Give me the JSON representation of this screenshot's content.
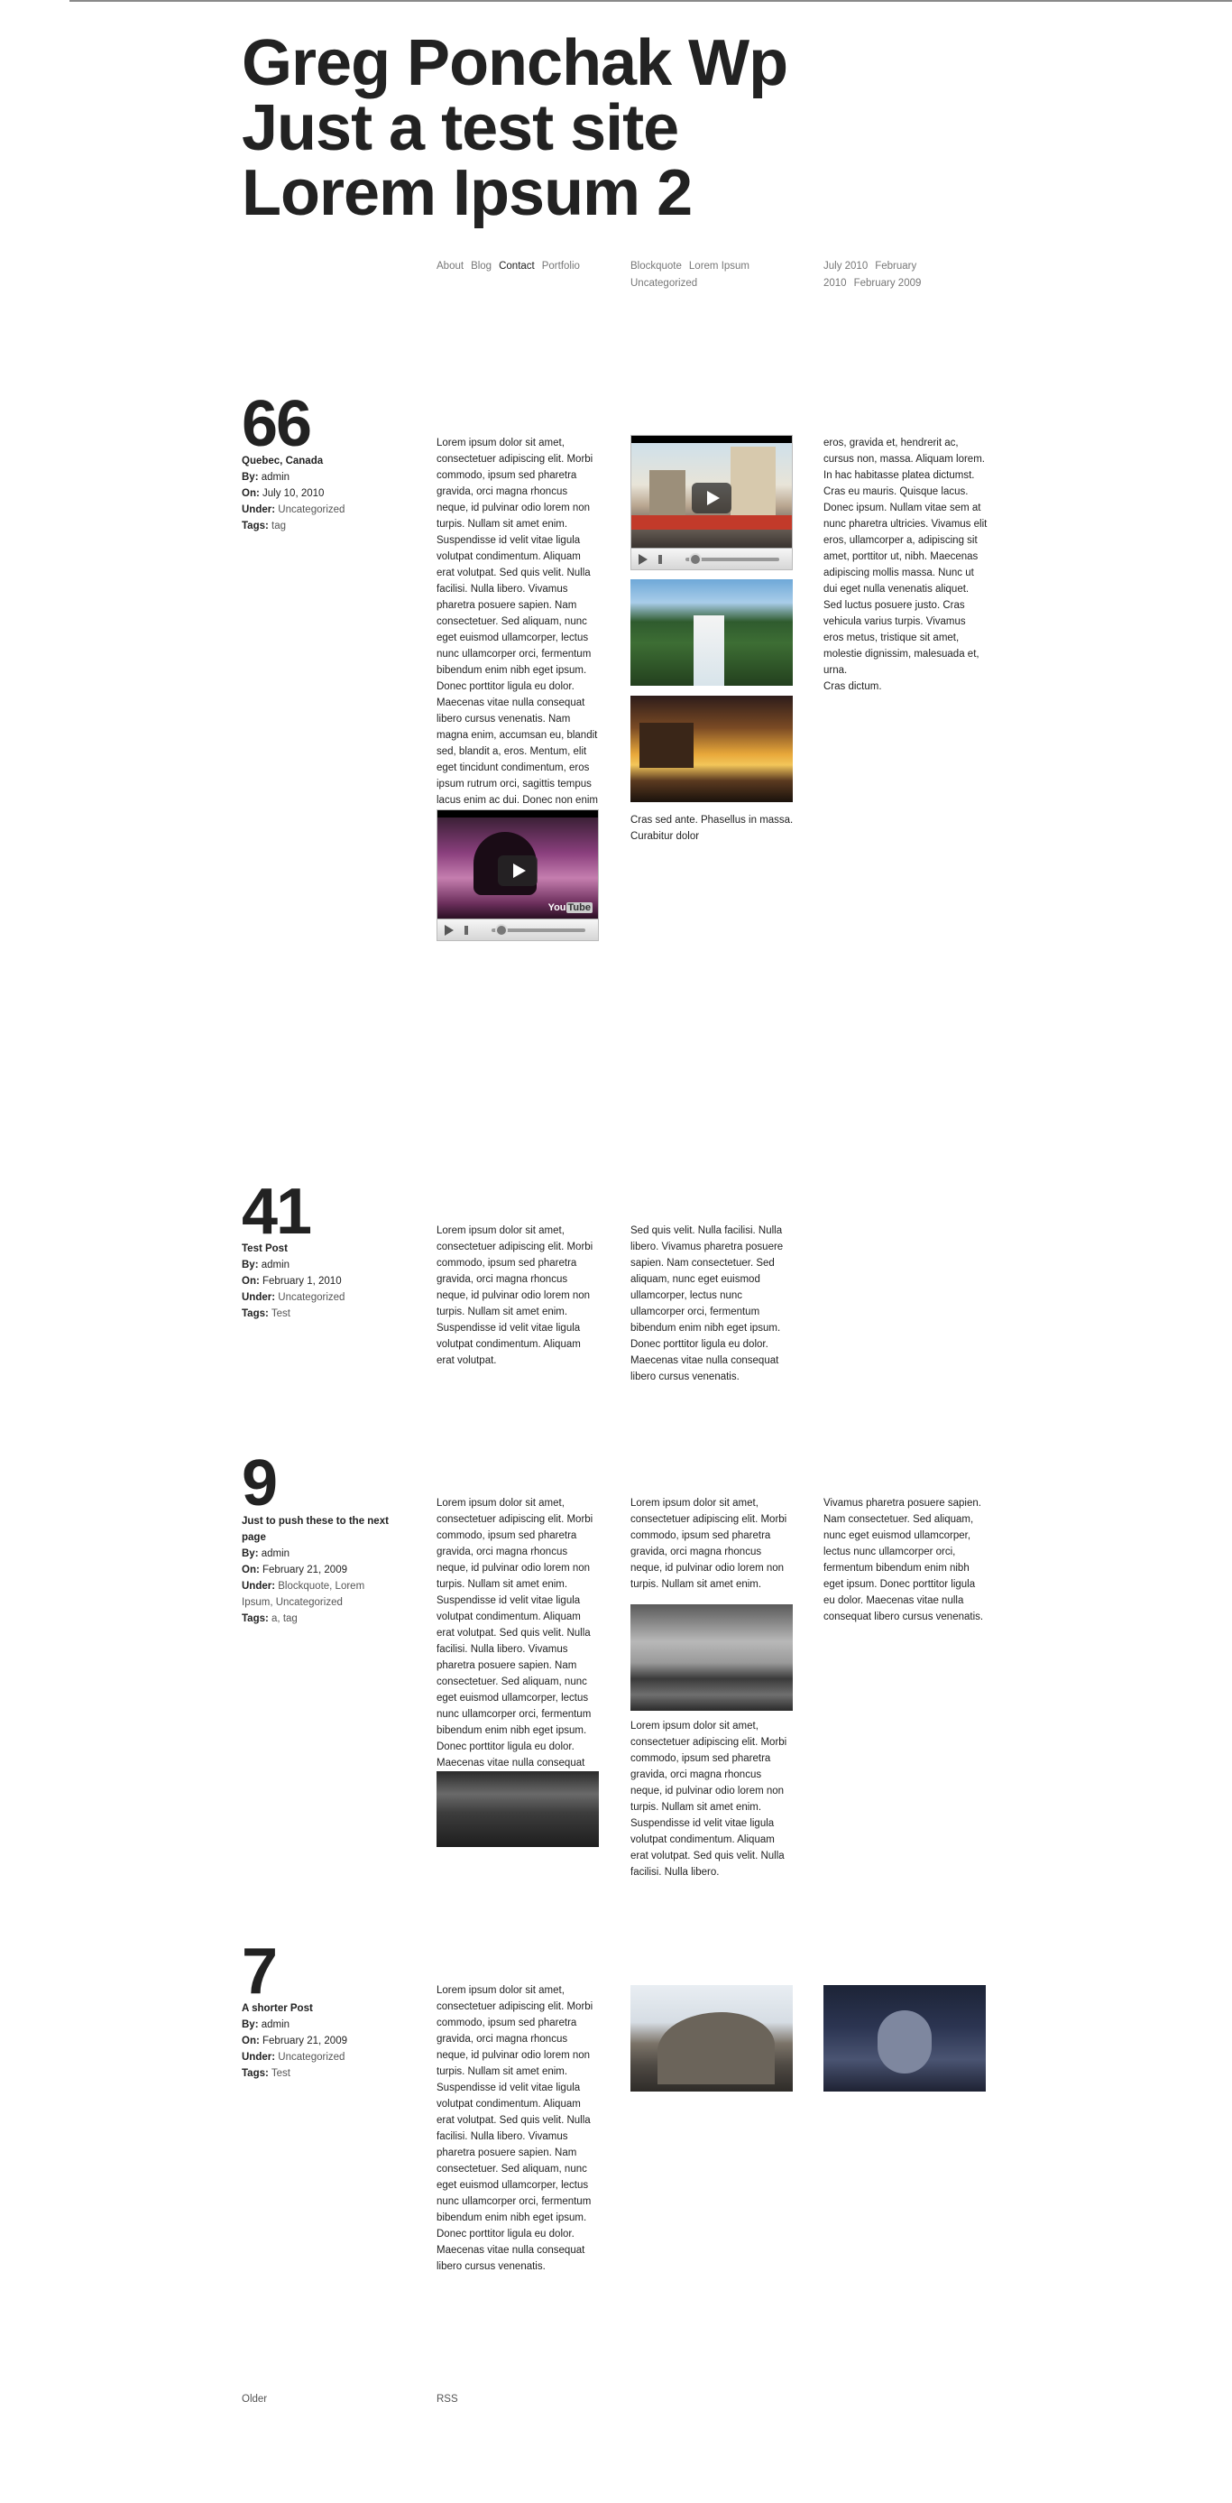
{
  "site": {
    "title_lines": [
      "Greg Ponchak Wp",
      "Just a test site",
      "Lorem Ipsum 2"
    ]
  },
  "nav": {
    "pages": [
      "About",
      "Blog",
      "Contact",
      "Portfolio"
    ],
    "categories": [
      "Blockquote",
      "Lorem Ipsum",
      "Uncategorized"
    ],
    "archives": [
      "July 2010",
      "February 2010",
      "February 2009"
    ]
  },
  "labels": {
    "by": "By:",
    "on": "On:",
    "under": "Under:",
    "tags": "Tags:"
  },
  "posts": [
    {
      "number": "66",
      "title": "Quebec, Canada",
      "author": "admin",
      "date": "July 10, 2010",
      "categories": "Uncategorized",
      "tags": "tag",
      "col1_text": "Lorem ipsum dolor sit amet, consectetuer adipiscing elit. Morbi commodo, ipsum sed pharetra gravida, orci magna rhoncus neque, id pulvinar odio lorem non turpis. Nullam sit amet enim. Suspendisse id velit vitae ligula volutpat condimentum. Aliquam erat volutpat. Sed quis velit. Nulla facilisi. Nulla libero. Vivamus pharetra posuere sapien. Nam consectetuer. Sed aliquam, nunc eget euismod ullamcorper, lectus nunc ullamcorper orci, fermentum bibendum enim nibh eget ipsum. Donec porttitor ligula eu dolor. Maecenas vitae nulla consequat libero cursus venenatis. Nam magna enim, accumsan eu, blandit sed, blandit a, eros. Mentum, elit eget tincidunt condimentum, eros ipsum rutrum orci, sagittis tempus lacus enim ac dui. Donec non enim in turpis pulvinar facilisis. Ut felis.",
      "col2_caption": "Cras sed ante. Phasellus in massa. Curabitur dolor",
      "col3_text": "eros, gravida et, hendrerit ac, cursus non, massa. Aliquam lorem. In hac habitasse platea dictumst. Cras eu mauris. Quisque lacus. Donec ipsum. Nullam vitae sem at nunc pharetra ultricies. Vivamus elit eros, ullamcorper a, adipiscing sit amet, porttitor ut, nibh. Maecenas adipiscing mollis massa. Nunc ut dui eget nulla venenatis aliquet. Sed luctus posuere justo. Cras vehicula varius turpis. Vivamus eros metus, tristique sit amet, molestie dignissim, malesuada et, urna.",
      "col3_text2": "Cras dictum."
    },
    {
      "number": "41",
      "title": "Test Post",
      "author": "admin",
      "date": "February 1, 2010",
      "categories": "Uncategorized",
      "tags": "Test",
      "col1_text": "Lorem ipsum dolor sit amet, consectetuer adipiscing elit. Morbi commodo, ipsum sed pharetra gravida, orci magna rhoncus neque, id pulvinar odio lorem non turpis. Nullam sit amet enim. Suspendisse id velit vitae ligula volutpat condimentum. Aliquam erat volutpat.",
      "col2_text": "Sed quis velit. Nulla facilisi. Nulla libero. Vivamus pharetra posuere sapien. Nam consectetuer. Sed aliquam, nunc eget euismod ullamcorper, lectus nunc ullamcorper orci, fermentum bibendum enim nibh eget ipsum. Donec porttitor ligula eu dolor. Maecenas vitae nulla consequat libero cursus venenatis."
    },
    {
      "number": "9",
      "title": "Just to push these to the next page",
      "author": "admin",
      "date": "February 21, 2009",
      "categories": "Blockquote, Lorem Ipsum, Uncategorized",
      "tags": "a, tag",
      "col1_text": "Lorem ipsum dolor sit amet, consectetuer adipiscing elit. Morbi commodo, ipsum sed pharetra gravida, orci magna rhoncus neque, id pulvinar odio lorem non turpis. Nullam sit amet enim. Suspendisse id velit vitae ligula volutpat condimentum. Aliquam erat volutpat. Sed quis velit. Nulla facilisi. Nulla libero. Vivamus pharetra posuere sapien. Nam consectetuer. Sed aliquam, nunc eget euismod ullamcorper, lectus nunc ullamcorper orci, fermentum bibendum enim nibh eget ipsum. Donec porttitor ligula eu dolor. Maecenas vitae nulla consequat libero cursus venenatis.",
      "col2_text": "Lorem ipsum dolor sit amet, consectetuer adipiscing elit. Morbi commodo, ipsum sed pharetra gravida, orci magna rhoncus neque, id pulvinar odio lorem non turpis. Nullam sit amet enim.",
      "col2_text2": "Lorem ipsum dolor sit amet, consectetuer adipiscing elit. Morbi commodo, ipsum sed pharetra gravida, orci magna rhoncus neque, id pulvinar odio lorem non turpis. Nullam sit amet enim. Suspendisse id velit vitae ligula volutpat condimentum. Aliquam erat volutpat. Sed quis velit. Nulla facilisi. Nulla libero.",
      "col3_text": "Vivamus pharetra posuere sapien. Nam consectetuer. Sed aliquam, nunc eget euismod ullamcorper, lectus nunc ullamcorper orci, fermentum bibendum enim nibh eget ipsum. Donec porttitor ligula eu dolor. Maecenas vitae nulla consequat libero cursus venenatis."
    },
    {
      "number": "7",
      "title": "A shorter Post",
      "author": "admin",
      "date": "February 21, 2009",
      "categories": "Uncategorized",
      "tags": "Test",
      "col1_text": "Lorem ipsum dolor sit amet, consectetuer adipiscing elit. Morbi commodo, ipsum sed pharetra gravida, orci magna rhoncus neque, id pulvinar odio lorem non turpis. Nullam sit amet enim. Suspendisse id velit vitae ligula volutpat condimentum. Aliquam erat volutpat. Sed quis velit. Nulla facilisi. Nulla libero. Vivamus pharetra posuere sapien. Nam consectetuer. Sed aliquam, nunc eget euismod ullamcorper, lectus nunc ullamcorper orci, fermentum bibendum enim nibh eget ipsum. Donec porttitor ligula eu dolor. Maecenas vitae nulla consequat libero cursus venenatis."
    }
  ],
  "video": {
    "brand": "You",
    "brand_box": "Tube"
  },
  "footer": {
    "older": "Older",
    "rss": "RSS"
  }
}
